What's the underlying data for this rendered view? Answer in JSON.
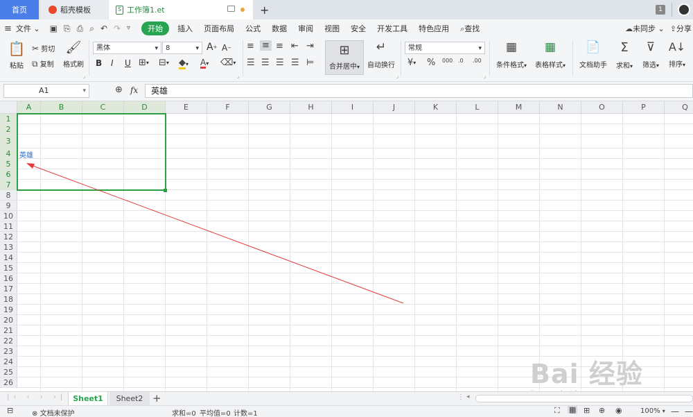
{
  "tabs": {
    "home": "首页",
    "template": "稻壳模板",
    "workbook": "工作簿1.et",
    "new_tab": "+",
    "badge": "1"
  },
  "menu": {
    "file": "文件",
    "items": [
      "开始",
      "插入",
      "页面布局",
      "公式",
      "数据",
      "审阅",
      "视图",
      "安全",
      "开发工具",
      "特色应用"
    ],
    "search": "查找",
    "sync": "未同步",
    "share": "分享"
  },
  "ribbon": {
    "paste": "粘贴",
    "cut": "剪切",
    "copy": "复制",
    "format_painter": "格式刷",
    "font_name": "黑体",
    "font_size": "8",
    "merge_center": "合并居中",
    "wrap_text": "自动换行",
    "number_format": "常规",
    "conditional_format": "条件格式",
    "table_style": "表格样式",
    "doc_assistant": "文档助手",
    "sum": "求和",
    "filter": "筛选",
    "sort": "排序"
  },
  "formula_bar": {
    "name_box": "A1",
    "fx": "fx",
    "content": "英雄"
  },
  "columns": [
    "A",
    "B",
    "C",
    "D",
    "E",
    "F",
    "G",
    "H",
    "I",
    "J",
    "K",
    "L",
    "M",
    "N",
    "O",
    "P",
    "Q"
  ],
  "rows": [
    "1",
    "2",
    "3",
    "4",
    "5",
    "6",
    "7",
    "8",
    "9",
    "10",
    "11",
    "12",
    "13",
    "14",
    "15",
    "16",
    "17",
    "18",
    "19",
    "20",
    "21",
    "22",
    "23",
    "24",
    "25",
    "26"
  ],
  "cell_text": "英雄",
  "sheets": [
    "Sheet1",
    "Sheet2"
  ],
  "status": {
    "protect": "文档未保护",
    "sum": "求和=0",
    "avg": "平均值=0",
    "count": "计数=1",
    "zoom": "100%"
  },
  "watermark": {
    "text": "Bai 经验",
    "url": "jingyan.baidu.com"
  },
  "colors": {
    "accent_green": "#26a450",
    "selection_green": "#2e9e44",
    "home_tab_blue": "#4a7ee8",
    "arrow_red": "#e23b3b"
  }
}
